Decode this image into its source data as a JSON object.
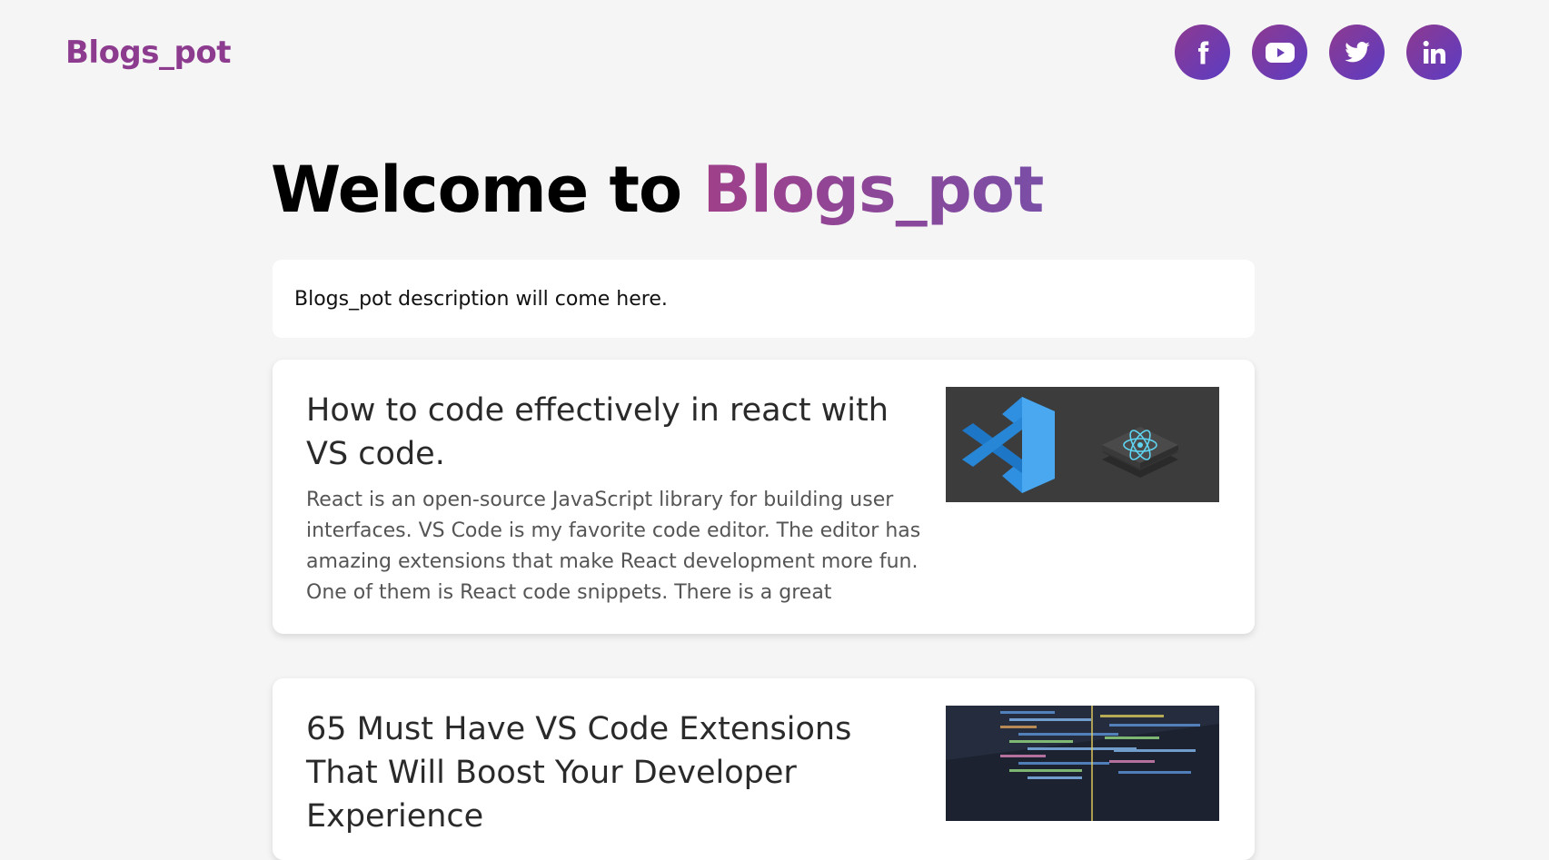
{
  "header": {
    "logo": "Blogs_pot",
    "socials": [
      {
        "icon": "facebook-icon"
      },
      {
        "icon": "youtube-icon"
      },
      {
        "icon": "twitter-icon"
      },
      {
        "icon": "linkedin-icon"
      }
    ]
  },
  "hero": {
    "title_prefix": "Welcome to ",
    "title_brand": "Blogs_pot",
    "description": "Blogs_pot description will come here."
  },
  "posts": [
    {
      "title": "How to code effectively in react with VS code.",
      "excerpt": "React is an open-source JavaScript library for building user interfaces. VS Code is my favorite code editor. The editor has amazing extensions that make React development more fun. One of them is React code snippets. There is a great extension for Re...",
      "thumb": "vscode-react-thumbnail"
    },
    {
      "title": "65 Must Have VS Code Extensions That Will Boost Your Developer Experience",
      "thumb": "code-editor-thumbnail"
    }
  ],
  "colors": {
    "brand": "#8c3b8f",
    "brand_gradient_end": "#5b3cc4",
    "background": "#f5f5f5"
  }
}
